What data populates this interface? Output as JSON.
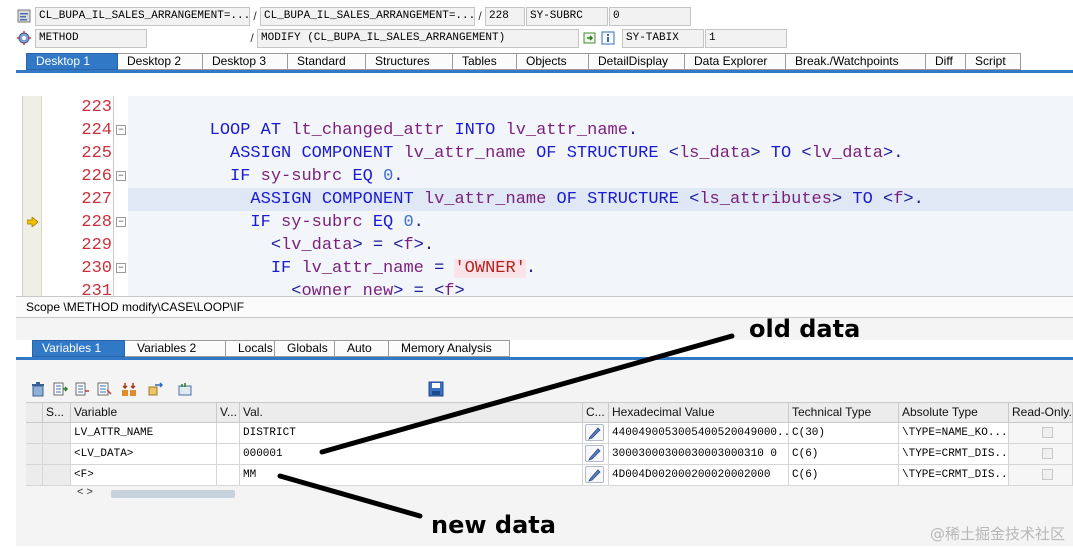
{
  "header": {
    "row1": {
      "program": "CL_BUPA_IL_SALES_ARRANGEMENT=...",
      "include": "CL_BUPA_IL_SALES_ARRANGEMENT=...",
      "line": "228",
      "sysvar_name": "SY-SUBRC",
      "sysvar_value": "0",
      "icon": "program-icon"
    },
    "row2": {
      "type": "METHOD",
      "event": "MODIFY (CL_BUPA_IL_SALES_ARRANGEMENT)",
      "sysvar_name": "SY-TABIX",
      "sysvar_value": "1",
      "icon": "method-icon"
    },
    "separator": "/"
  },
  "main_tabs": [
    {
      "label": "Desktop 1",
      "active": true
    },
    {
      "label": "Desktop 2"
    },
    {
      "label": "Desktop 3"
    },
    {
      "label": "Standard"
    },
    {
      "label": "Structures"
    },
    {
      "label": "Tables"
    },
    {
      "label": "Objects"
    },
    {
      "label": "DetailDisplay"
    },
    {
      "label": "Data Explorer"
    },
    {
      "label": "Break./Watchpoints"
    },
    {
      "label": "Diff"
    },
    {
      "label": "Script"
    }
  ],
  "editor": {
    "current_line": "228",
    "lines": [
      {
        "no": "223"
      },
      {
        "no": "224"
      },
      {
        "no": "225"
      },
      {
        "no": "226"
      },
      {
        "no": "227"
      },
      {
        "no": "228"
      },
      {
        "no": "229"
      },
      {
        "no": "230"
      },
      {
        "no": "231"
      }
    ],
    "code": {
      "l224": [
        "LOOP",
        "AT",
        "lt_changed_attr",
        "INTO",
        "lv_attr_name",
        "."
      ],
      "l225": [
        "ASSIGN",
        "COMPONENT",
        "lv_attr_name",
        "OF",
        "STRUCTURE",
        "<",
        "ls_data",
        ">",
        "TO",
        "<",
        "lv_data",
        ">",
        "."
      ],
      "l226": [
        "IF",
        "sy-subrc",
        "EQ",
        "0",
        "."
      ],
      "l227": [
        "ASSIGN",
        "COMPONENT",
        "lv_attr_name",
        "OF",
        "STRUCTURE",
        "<",
        "ls_attributes",
        ">",
        "TO",
        "<",
        "f",
        ">",
        "."
      ],
      "l228": [
        "IF",
        "sy-subrc",
        "EQ",
        "0",
        "."
      ],
      "l229": [
        "<",
        "lv_data",
        ">",
        "=",
        "<",
        "f",
        ">",
        "."
      ],
      "l230": [
        "IF",
        "lv_attr_name",
        "=",
        "'OWNER'",
        "."
      ],
      "l231": [
        "<",
        "owner_new",
        ">",
        "=",
        "<",
        "f",
        ">"
      ]
    }
  },
  "scope": "Scope \\METHOD modify\\CASE\\LOOP\\IF",
  "var_tabs": [
    {
      "label": "Variables 1",
      "active": true
    },
    {
      "label": "Variables 2"
    },
    {
      "label": "Locals"
    },
    {
      "label": "Globals"
    },
    {
      "label": "Auto"
    },
    {
      "label": "Memory Analysis"
    }
  ],
  "toolbar_icons": [
    "delete-icon",
    "import-icon",
    "export-icon",
    "list-icon",
    "hierarchy-icon",
    "transfer-icon",
    "settings-icon",
    "save-icon"
  ],
  "grid": {
    "columns": [
      "S...",
      "Variable",
      "V...",
      "Val.",
      "C...",
      "Hexadecimal Value",
      "Technical Type",
      "Absolute Type",
      "Read-Only."
    ],
    "rows": [
      {
        "variable": "LV_ATTR_NAME",
        "value": "DISTRICT",
        "hex": "4400490053005400520049000...",
        "tech": "C(30)",
        "abs": "\\TYPE=NAME_KO...",
        "readonly": false
      },
      {
        "variable": "<LV_DATA>",
        "value": "000001",
        "hex": "30003000300030003000310 0",
        "tech": "C(6)",
        "abs": "\\TYPE=CRMT_DIS...",
        "readonly": false
      },
      {
        "variable": "<F>",
        "value": "MM",
        "hex": "4D004D002000200020002000",
        "tech": "C(6)",
        "abs": "\\TYPE=CRMT_DIS...",
        "readonly": false
      }
    ],
    "scroll_arrows": "< >"
  },
  "annotations": {
    "old": "old data",
    "new": "new data"
  },
  "watermark": "@稀土掘金技术社区",
  "colors": {
    "active_tab": "#3178c6",
    "line_numbers": "#c8323c",
    "keyword": "#1a1ad0",
    "string": "#b3241d"
  }
}
